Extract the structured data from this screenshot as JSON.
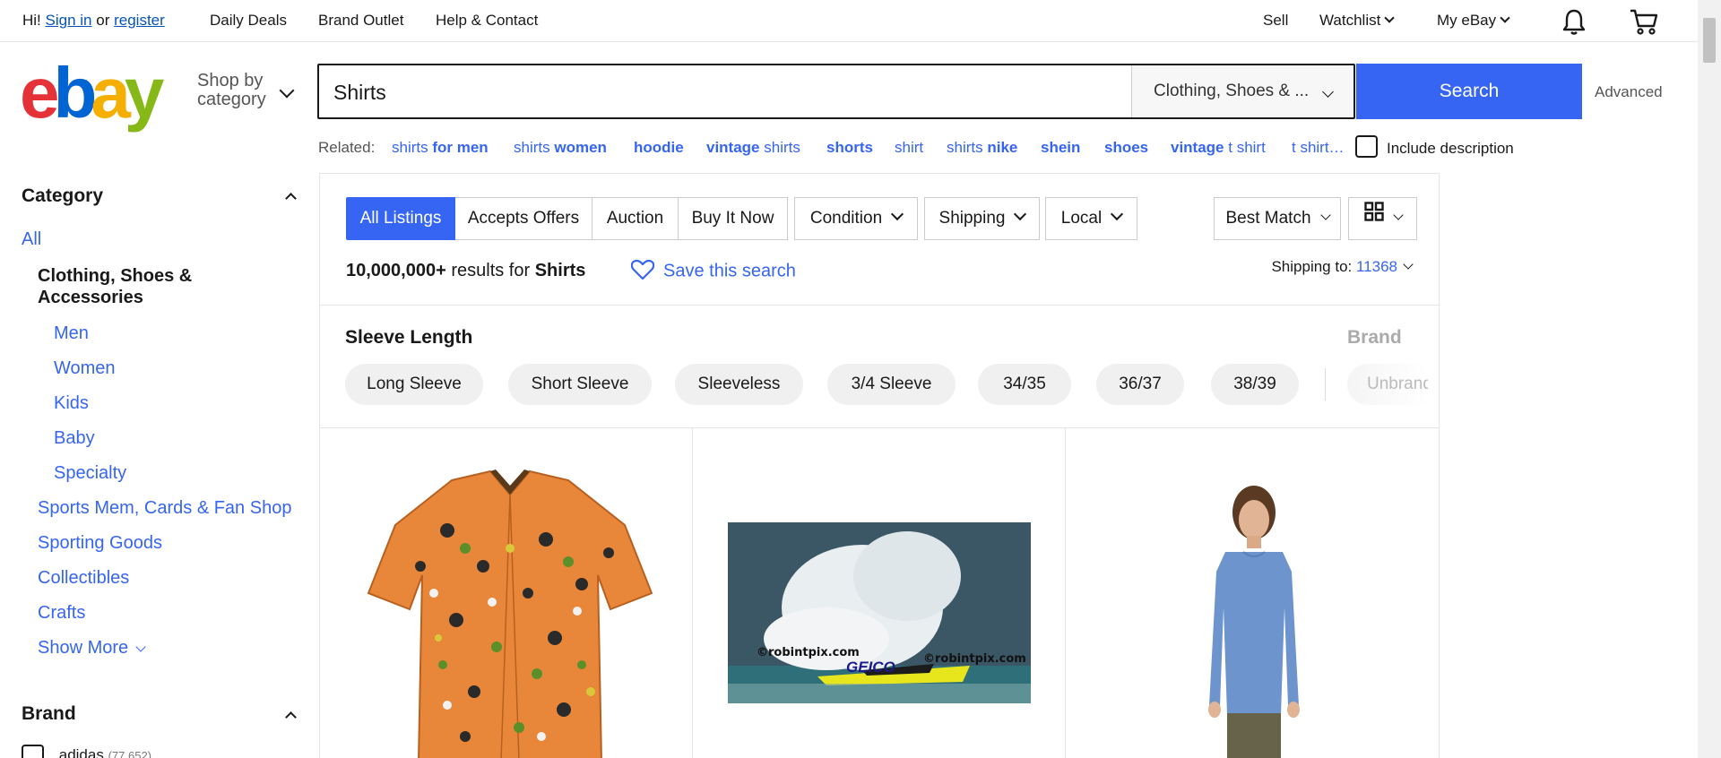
{
  "topbar": {
    "greeting": "Hi!",
    "sign_in": "Sign in",
    "or": "or",
    "register": "register",
    "links": [
      "Daily Deals",
      "Brand Outlet",
      "Help & Contact"
    ],
    "sell": "Sell",
    "watchlist": "Watchlist",
    "my_ebay": "My eBay",
    "icons": [
      "bell-icon",
      "cart-icon"
    ]
  },
  "header": {
    "logo_letters": [
      "e",
      "b",
      "a",
      "y"
    ],
    "logo_colors": [
      "#e53238",
      "#0064d2",
      "#f5af02",
      "#86b817"
    ],
    "shop_by_line1": "Shop by",
    "shop_by_line2": "category",
    "search_value": "Shirts",
    "category_select": "Clothing, Shoes & ...",
    "search_button": "Search",
    "advanced": "Advanced"
  },
  "related": {
    "label": "Related:",
    "items": [
      {
        "plain": "shirts ",
        "bold": "for men"
      },
      {
        "plain": "shirts ",
        "bold": "women"
      },
      {
        "plain": "",
        "bold": "hoodie"
      },
      {
        "plain": " shirts",
        "bold": "vintage"
      },
      {
        "plain": "",
        "bold": "shorts"
      },
      {
        "plain": "shirt",
        "bold": ""
      },
      {
        "plain": "shirts ",
        "bold": "nike"
      },
      {
        "plain": "",
        "bold": "shein"
      },
      {
        "plain": "",
        "bold": "shoes"
      },
      {
        "plain": " t shirt",
        "bold": "vintage"
      },
      {
        "plain": "t shirt…",
        "bold": ""
      }
    ],
    "include_description": "Include description"
  },
  "sidebar": {
    "category_heading": "Category",
    "all": "All",
    "current_category": "Clothing, Shoes & Accessories",
    "subcategories": [
      "Men",
      "Women",
      "Kids",
      "Baby",
      "Specialty"
    ],
    "categories": [
      "Sports Mem, Cards & Fan Shop",
      "Sporting Goods",
      "Collectibles",
      "Crafts"
    ],
    "show_more": "Show More",
    "brand_heading": "Brand",
    "brand_first": "adidas",
    "brand_first_count": "(77,652)"
  },
  "filters": {
    "tabs": [
      "All Listings",
      "Accepts Offers",
      "Auction",
      "Buy It Now"
    ],
    "dropdowns": [
      "Condition",
      "Shipping",
      "Local"
    ],
    "sort": "Best Match"
  },
  "results": {
    "count": "10,000,000+",
    "text": " results for ",
    "query": "Shirts",
    "save_search": "Save this search",
    "shipping_label": "Shipping to: ",
    "zip": "11368"
  },
  "sleeve": {
    "title": "Sleeve Length",
    "chips": [
      "Long Sleeve",
      "Short Sleeve",
      "Sleeveless",
      "3/4 Sleeve",
      "34/35",
      "36/37",
      "38/39"
    ],
    "brand_title": "Brand",
    "brand_chip": "Unbrand"
  },
  "products": {
    "boat_watermark_1": "©robintpix.com",
    "boat_watermark_2": "©robintpix.com",
    "boat_brand": "GEICO"
  }
}
